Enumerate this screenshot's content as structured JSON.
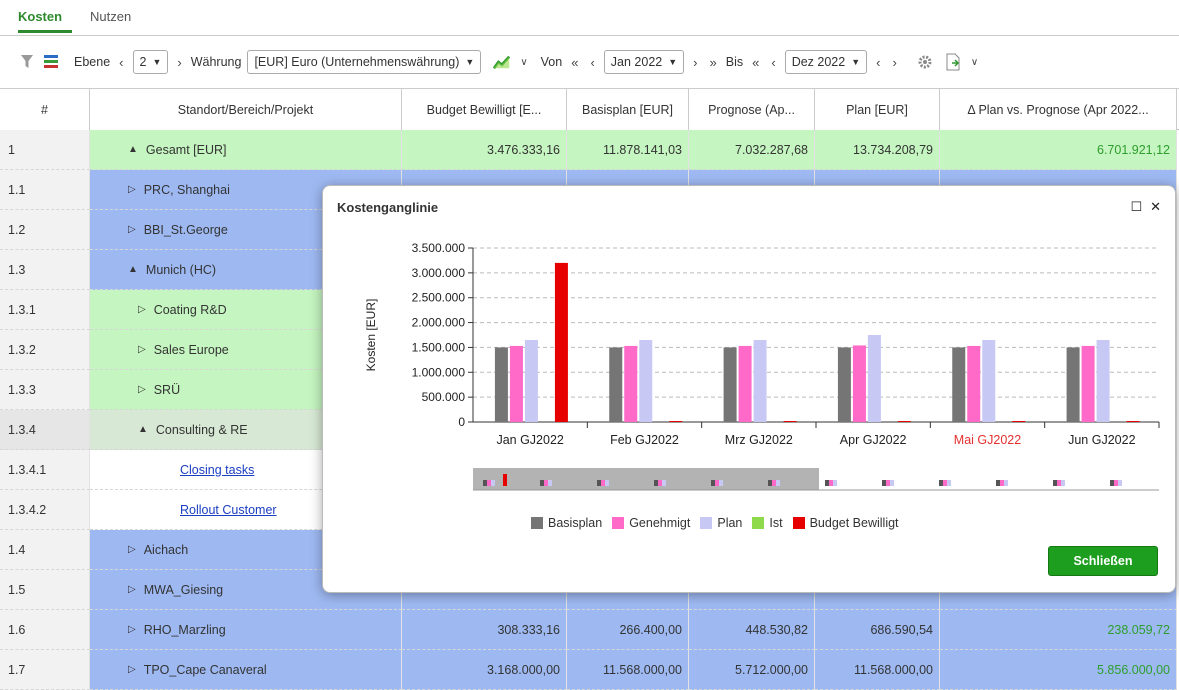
{
  "tabs": [
    {
      "label": "Kosten",
      "active": true
    },
    {
      "label": "Nutzen",
      "active": false
    }
  ],
  "toolbar": {
    "ebene_label": "Ebene",
    "ebene_value": "2",
    "waehrung_label": "Währung",
    "waehrung_value": "[EUR] Euro (Unternehmenswährung)",
    "von_label": "Von",
    "von_value": "Jan 2022",
    "bis_label": "Bis",
    "bis_value": "Dez 2022"
  },
  "table": {
    "headers": [
      "#",
      "Standort/Bereich/Projekt",
      "Budget Bewilligt [E...",
      "Basisplan [EUR]",
      "Prognose (Ap...",
      "Plan [EUR]",
      "Δ Plan vs. Prognose (Apr 2022..."
    ],
    "rows": [
      {
        "num": "1",
        "name": "Gesamt [EUR]",
        "icon": "▲",
        "bg": "green",
        "budget": "3.476.333,16",
        "basis": "11.878.141,03",
        "prog": "7.032.287,68",
        "plan": "13.734.208,79",
        "delta": "6.701.921,12"
      },
      {
        "num": "1.1",
        "name": "PRC, Shanghai",
        "icon": "▷",
        "bg": "blue"
      },
      {
        "num": "1.2",
        "name": "BBI_St.George",
        "icon": "▷",
        "bg": "blue"
      },
      {
        "num": "1.3",
        "name": "Munich (HC)",
        "icon": "▲",
        "bg": "blue"
      },
      {
        "num": "1.3.1",
        "name": "Coating R&D",
        "icon": "▷",
        "bg": "green",
        "indent": 1
      },
      {
        "num": "1.3.2",
        "name": "Sales Europe",
        "icon": "▷",
        "bg": "green",
        "indent": 1
      },
      {
        "num": "1.3.3",
        "name": "SRÜ",
        "icon": "▷",
        "bg": "green",
        "indent": 1
      },
      {
        "num": "1.3.4",
        "name": "Consulting & RE",
        "icon": "▲",
        "bg": "sel",
        "indent": 1
      },
      {
        "num": "1.3.4.1",
        "name": "Closing tasks",
        "bg": "white",
        "link": true
      },
      {
        "num": "1.3.4.2",
        "name": "Rollout Customer",
        "bg": "white",
        "link": true
      },
      {
        "num": "1.4",
        "name": "Aichach",
        "icon": "▷",
        "bg": "blue"
      },
      {
        "num": "1.5",
        "name": "MWA_Giesing",
        "icon": "▷",
        "bg": "blue"
      },
      {
        "num": "1.6",
        "name": "RHO_Marzling",
        "icon": "▷",
        "bg": "blue",
        "budget": "308.333,16",
        "basis": "266.400,00",
        "prog": "448.530,82",
        "plan": "686.590,54",
        "delta": "238.059,72"
      },
      {
        "num": "1.7",
        "name": "TPO_Cape Canaveral",
        "icon": "▷",
        "bg": "blue",
        "budget": "3.168.000,00",
        "basis": "11.568.000,00",
        "prog": "5.712.000,00",
        "plan": "11.568.000,00",
        "delta": "5.856.000,00"
      }
    ]
  },
  "modal": {
    "title": "Kostenganglinie",
    "close_label": "Schließen",
    "legend": [
      {
        "label": "Basisplan",
        "color": "#757575"
      },
      {
        "label": "Genehmigt",
        "color": "#ff69c8"
      },
      {
        "label": "Plan",
        "color": "#c8c8f5"
      },
      {
        "label": "Ist",
        "color": "#8fd94d"
      },
      {
        "label": "Budget Bewilligt",
        "color": "#e60000"
      }
    ]
  },
  "chart_data": {
    "type": "bar",
    "title": "",
    "ylabel": "Kosten [EUR]",
    "ylim": [
      0,
      3500000
    ],
    "yticks": [
      "0",
      "500.000",
      "1.000.000",
      "1.500.000",
      "2.000.000",
      "2.500.000",
      "3.000.000",
      "3.500.000"
    ],
    "categories": [
      "Jan GJ2022",
      "Feb GJ2022",
      "Mrz GJ2022",
      "Apr GJ2022",
      "Mai GJ2022",
      "Jun GJ2022"
    ],
    "highlight_category": "Mai GJ2022",
    "series": [
      {
        "name": "Basisplan",
        "color": "#757575",
        "values": [
          1500000,
          1500000,
          1500000,
          1500000,
          1500000,
          1500000
        ]
      },
      {
        "name": "Genehmigt",
        "color": "#ff69c8",
        "values": [
          1530000,
          1530000,
          1530000,
          1540000,
          1530000,
          1530000
        ]
      },
      {
        "name": "Plan",
        "color": "#c8c8f5",
        "values": [
          1650000,
          1650000,
          1650000,
          1750000,
          1650000,
          1650000
        ]
      },
      {
        "name": "Ist",
        "color": "#8fd94d",
        "values": [
          0,
          0,
          0,
          0,
          0,
          0
        ]
      },
      {
        "name": "Budget Bewilligt",
        "color": "#e60000",
        "values": [
          3200000,
          20000,
          20000,
          20000,
          20000,
          20000
        ]
      }
    ]
  }
}
